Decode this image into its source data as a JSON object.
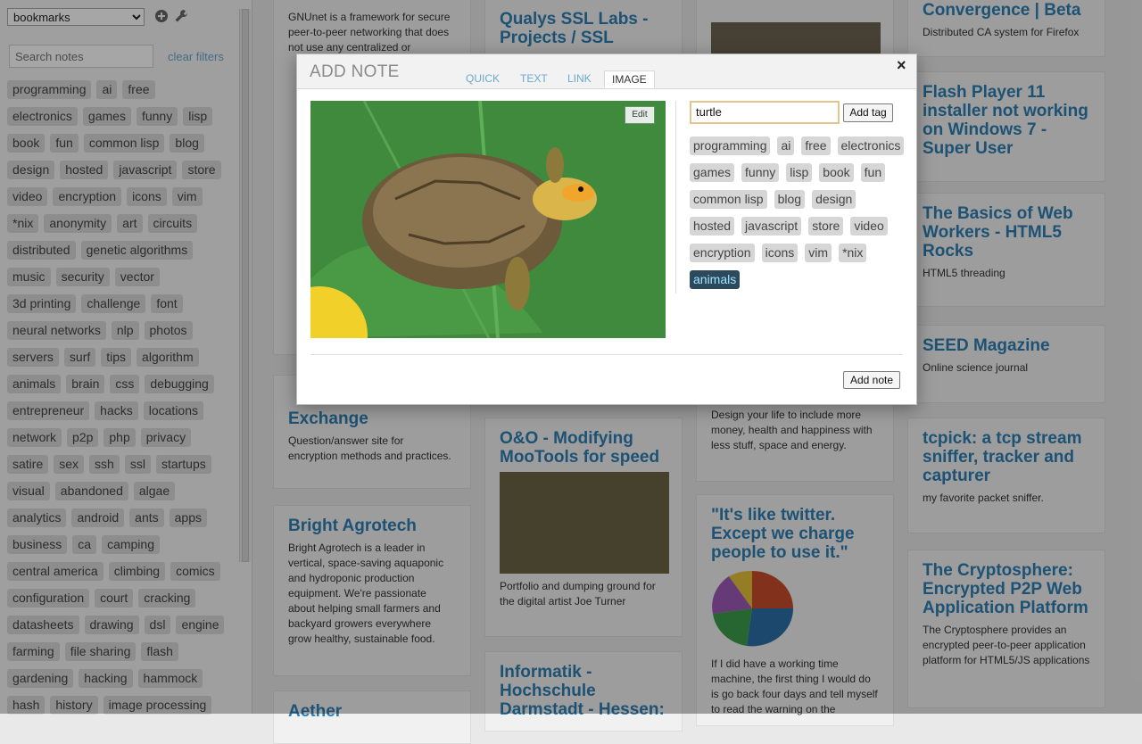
{
  "sidebar": {
    "collection": "bookmarks",
    "search_placeholder": "Search notes",
    "clear_filters": "clear filters",
    "tags": [
      "programming",
      "ai",
      "free",
      "electronics",
      "games",
      "funny",
      "lisp",
      "book",
      "fun",
      "common lisp",
      "blog",
      "design",
      "hosted",
      "javascript",
      "store",
      "video",
      "encryption",
      "icons",
      "vim",
      "*nix",
      "anonymity",
      "art",
      "circuits",
      "distributed",
      "genetic algorithms",
      "music",
      "security",
      "vector",
      "3d printing",
      "challenge",
      "font",
      "neural networks",
      "nlp",
      "photos",
      "servers",
      "surf",
      "tips",
      "algorithm",
      "animals",
      "brain",
      "css",
      "debugging",
      "entrepreneur",
      "hacks",
      "locations",
      "network",
      "p2p",
      "php",
      "privacy",
      "satire",
      "sex",
      "ssh",
      "ssl",
      "startups",
      "visual",
      "abandoned",
      "algae",
      "analytics",
      "android",
      "ants",
      "apps",
      "business",
      "ca",
      "camping",
      "central america",
      "climbing",
      "comics",
      "configuration",
      "court",
      "cracking",
      "datasheets",
      "drawing",
      "dsl",
      "engine",
      "farming",
      "file sharing",
      "flash",
      "gardening",
      "hacking",
      "hammock",
      "hash",
      "history",
      "image processing"
    ]
  },
  "cards": {
    "gnunet": {
      "desc": "GNUnet is a framework for secure peer-to-peer networking that does not use any centralized or"
    },
    "qualys": {
      "title": "Qualys SSL Labs - Projects / SSL"
    },
    "convergence": {
      "title": "Convergence | Beta",
      "desc": "Distributed CA system for Firefox"
    },
    "flash": {
      "title": "Flash Player 11 installer not working on Windows 7 - Super User"
    },
    "webworkers": {
      "title": "The Basics of Web Workers - HTML5 Rocks",
      "desc": "HTML5 threading"
    },
    "seed": {
      "title": "SEED Magazine",
      "desc": "Online science journal"
    },
    "crypto_se": {
      "title": "Exchange",
      "desc": "Question/answer site for encryption methods and practices."
    },
    "oo": {
      "title": "O&O - Modifying MooTools for speed",
      "desc": "Portfolio and dumping ground for the digital artist Joe Turner"
    },
    "design_life": {
      "desc": "Design your life to include more money, health and happiness with less stuff, space and energy."
    },
    "tcpick": {
      "title": "tcpick: a tcp stream sniffer, tracker and capturer",
      "desc": "my favorite packet sniffer."
    },
    "bright": {
      "title": "Bright Agrotech",
      "desc": "Bright Agrotech is a leader in vertical, space-saving aquaponic and hydroponic production equipment. We're passionate about helping small farmers and backyard growers everywhere grow healthy, sustainable food."
    },
    "twitter": {
      "title": "\"It's like twitter. Except we charge people to use it.\"",
      "desc": "If I did have a working time machine, the first thing I would do is go back four days and tell myself to read the warning on the"
    },
    "cryptosphere": {
      "title": "The Cryptosphere: Encrypted P2P Web Application Platform",
      "desc": "The Cryptosphere provides an encrypted peer-to-peer application platform for HTML5/JS applications"
    },
    "informatik": {
      "title": "Informatik - Hochschule Darmstadt - Hessen:"
    },
    "aether": {
      "title": "Aether"
    }
  },
  "modal": {
    "title": "ADD NOTE",
    "tabs": [
      "QUICK",
      "TEXT",
      "LINK",
      "IMAGE"
    ],
    "active_tab": "IMAGE",
    "close": "×",
    "edit_label": "Edit",
    "tag_input_value": "turtle",
    "add_tag_label": "Add tag",
    "add_note_label": "Add note",
    "tags": [
      "programming",
      "ai",
      "free",
      "electronics",
      "games",
      "funny",
      "lisp",
      "book",
      "fun",
      "common lisp",
      "blog",
      "design",
      "hosted",
      "javascript",
      "store",
      "video",
      "encryption",
      "icons",
      "vim",
      "*nix",
      "animals"
    ],
    "selected_tag": "animals"
  },
  "colors": {
    "link": "#2d7fb3",
    "accent_tab": "#6aa8cf",
    "selected_tag_bg": "#2d4a5c",
    "selected_tag_fg": "#9fe3ff"
  }
}
